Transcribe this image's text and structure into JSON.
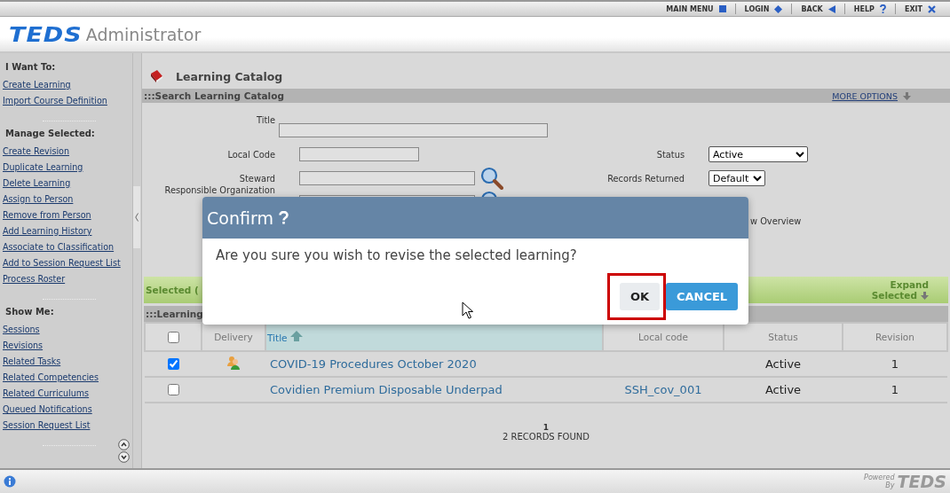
{
  "top_nav": [
    {
      "label": "MAIN MENU",
      "kind": "square"
    },
    {
      "label": "LOGIN",
      "kind": "diamond"
    },
    {
      "label": "BACK",
      "kind": "back"
    },
    {
      "label": "HELP",
      "kind": "help"
    },
    {
      "label": "EXIT",
      "kind": "close"
    }
  ],
  "header": {
    "logo": "TEDS",
    "app_name": "Administrator"
  },
  "sidebar": {
    "sections": [
      {
        "heading": "I Want To:",
        "links": [
          "Create Learning",
          "Import Course Definition"
        ]
      },
      {
        "heading": "Manage Selected:",
        "links": [
          "Create Revision",
          "Duplicate Learning",
          "Delete Learning",
          "Assign to Person",
          "Remove from Person",
          "Add Learning History",
          "Associate to Classification",
          "Add to Session Request List",
          "Process Roster"
        ]
      },
      {
        "heading": "Show Me:",
        "links": [
          "Sessions",
          "Revisions",
          "Related Tasks",
          "Related Competencies",
          "Related Curriculums",
          "Queued Notifications",
          "Session Request List"
        ]
      }
    ]
  },
  "page_title": "Learning Catalog",
  "search": {
    "title": ":::Search Learning Catalog",
    "more_options": "MORE OPTIONS",
    "fields": [
      {
        "label": "Title",
        "lookup": false
      },
      {
        "label": "Local Code",
        "lookup": false
      },
      {
        "label": "Steward",
        "lookup": true
      },
      {
        "label": "Responsible Organization",
        "lookup": true
      }
    ],
    "status": {
      "label": "Status",
      "value": "Active"
    },
    "records_returned": {
      "label": "Records Returned",
      "value": "Default"
    },
    "partial_option": "w Overview"
  },
  "selected_bar": {
    "label": "Selected (",
    "expand_line_1": "Expand",
    "expand_line_2": "Selected"
  },
  "results": {
    "title": ":::Learning",
    "select_all_checked": false,
    "columns": [
      {
        "label": "Delivery",
        "sorted": false
      },
      {
        "label": "Title",
        "sorted": true
      },
      {
        "label": "Local code",
        "sorted": false
      },
      {
        "label": "Status",
        "sorted": false
      },
      {
        "label": "Revision",
        "sorted": false
      }
    ],
    "rows": [
      {
        "checked": true,
        "delivery_icon": true,
        "title": "COVID-19 Procedures October 2020",
        "status": "Active",
        "revision": "1"
      },
      {
        "checked": false,
        "delivery_icon": false,
        "title": "Covidien Premium Disposable Underpad",
        "local_code": "SSH_cov_001",
        "status": "Active",
        "revision": "1"
      }
    ],
    "page": "1",
    "records_found": "2 RECORDS FOUND"
  },
  "dialog": {
    "title": "Confirm",
    "message": "Are you sure you wish to revise the selected learning?",
    "buttons": [
      {
        "label": "OK",
        "kind": "secondary",
        "highlighted": true
      },
      {
        "label": "CANCEL",
        "kind": "primary",
        "highlighted": false
      }
    ]
  },
  "footer": {
    "powered": "Powered",
    "by": "By",
    "logo": "TEDS"
  }
}
